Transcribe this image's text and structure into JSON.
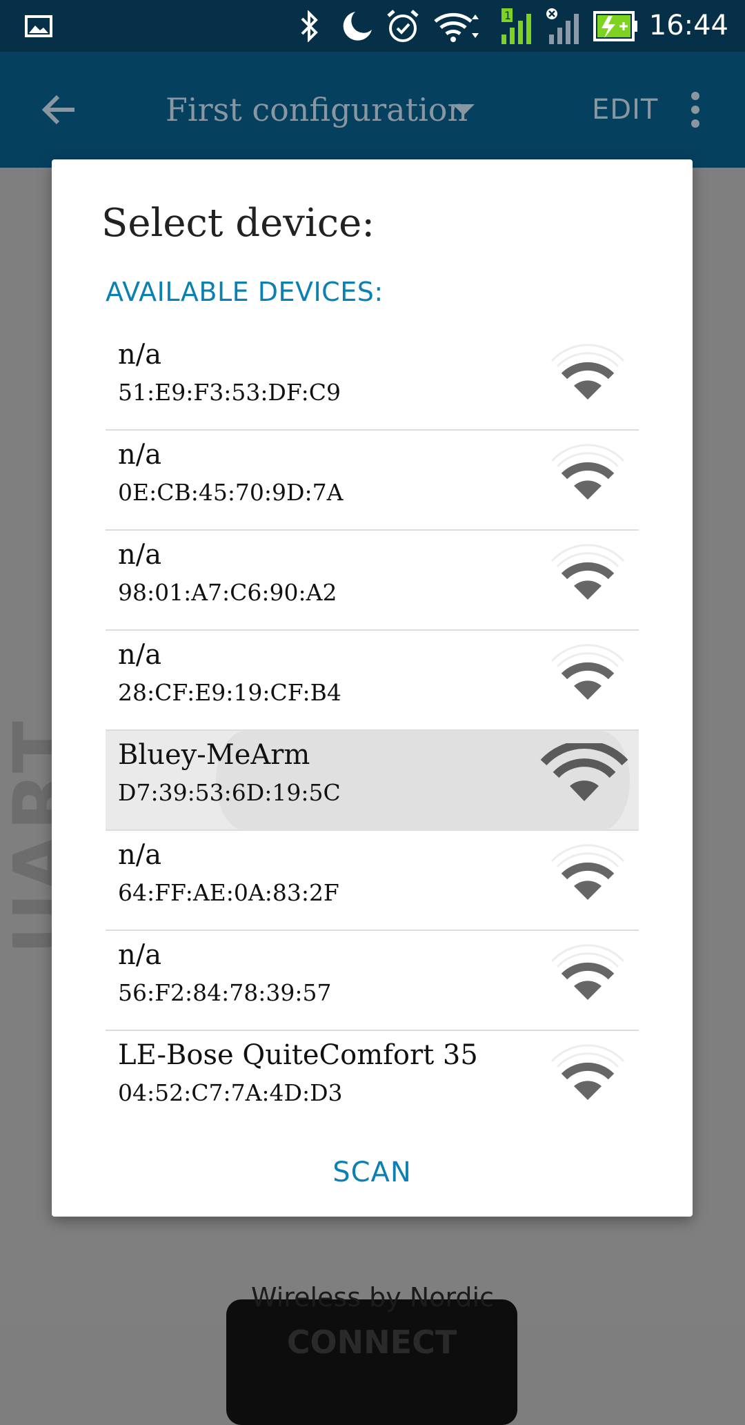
{
  "status_bar": {
    "time": "16:44",
    "icons": [
      "gallery-icon",
      "bluetooth-icon",
      "do-not-disturb-icon",
      "alarm-icon",
      "wifi-icon",
      "cell-signal-sim1-icon",
      "cell-signal-sim2-icon",
      "battery-charging-icon"
    ],
    "sim1_badge": "1"
  },
  "app_bar": {
    "back_icon": "back-arrow-icon",
    "title": "First configuration",
    "edit_label": "EDIT",
    "overflow_icon": "more-vert-icon"
  },
  "background": {
    "side_label": "UART",
    "connect_label": "CONNECT",
    "footer": "Wireless by Nordic"
  },
  "dialog": {
    "title": "Select device:",
    "section_label": "AVAILABLE DEVICES:",
    "scan_label": "SCAN",
    "devices": [
      {
        "name": "n/a",
        "address": "51:E9:F3:53:DF:C9",
        "signal_icon": "signal-strength-icon",
        "signal_bars": 2
      },
      {
        "name": "n/a",
        "address": "0E:CB:45:70:9D:7A",
        "signal_icon": "signal-strength-icon",
        "signal_bars": 2
      },
      {
        "name": "n/a",
        "address": "98:01:A7:C6:90:A2",
        "signal_icon": "signal-strength-icon",
        "signal_bars": 2
      },
      {
        "name": "n/a",
        "address": "28:CF:E9:19:CF:B4",
        "signal_icon": "signal-strength-icon",
        "signal_bars": 2
      },
      {
        "name": "Bluey-MeArm",
        "address": "D7:39:53:6D:19:5C",
        "signal_icon": "signal-strength-icon",
        "signal_bars": 3,
        "selected": true
      },
      {
        "name": "n/a",
        "address": "64:FF:AE:0A:83:2F",
        "signal_icon": "signal-strength-icon",
        "signal_bars": 2
      },
      {
        "name": "n/a",
        "address": "56:F2:84:78:39:57",
        "signal_icon": "signal-strength-icon",
        "signal_bars": 2
      },
      {
        "name": "LE-Bose QuiteComfort 35",
        "address": "04:52:C7:7A:4D:D3",
        "signal_icon": "signal-strength-icon",
        "signal_bars": 2
      }
    ]
  },
  "colors": {
    "status_bar": "#053048",
    "app_bar": "#06405f",
    "accent": "#0a80b4",
    "scrim": "#7f7f7f",
    "battery_green": "#7ed321"
  }
}
